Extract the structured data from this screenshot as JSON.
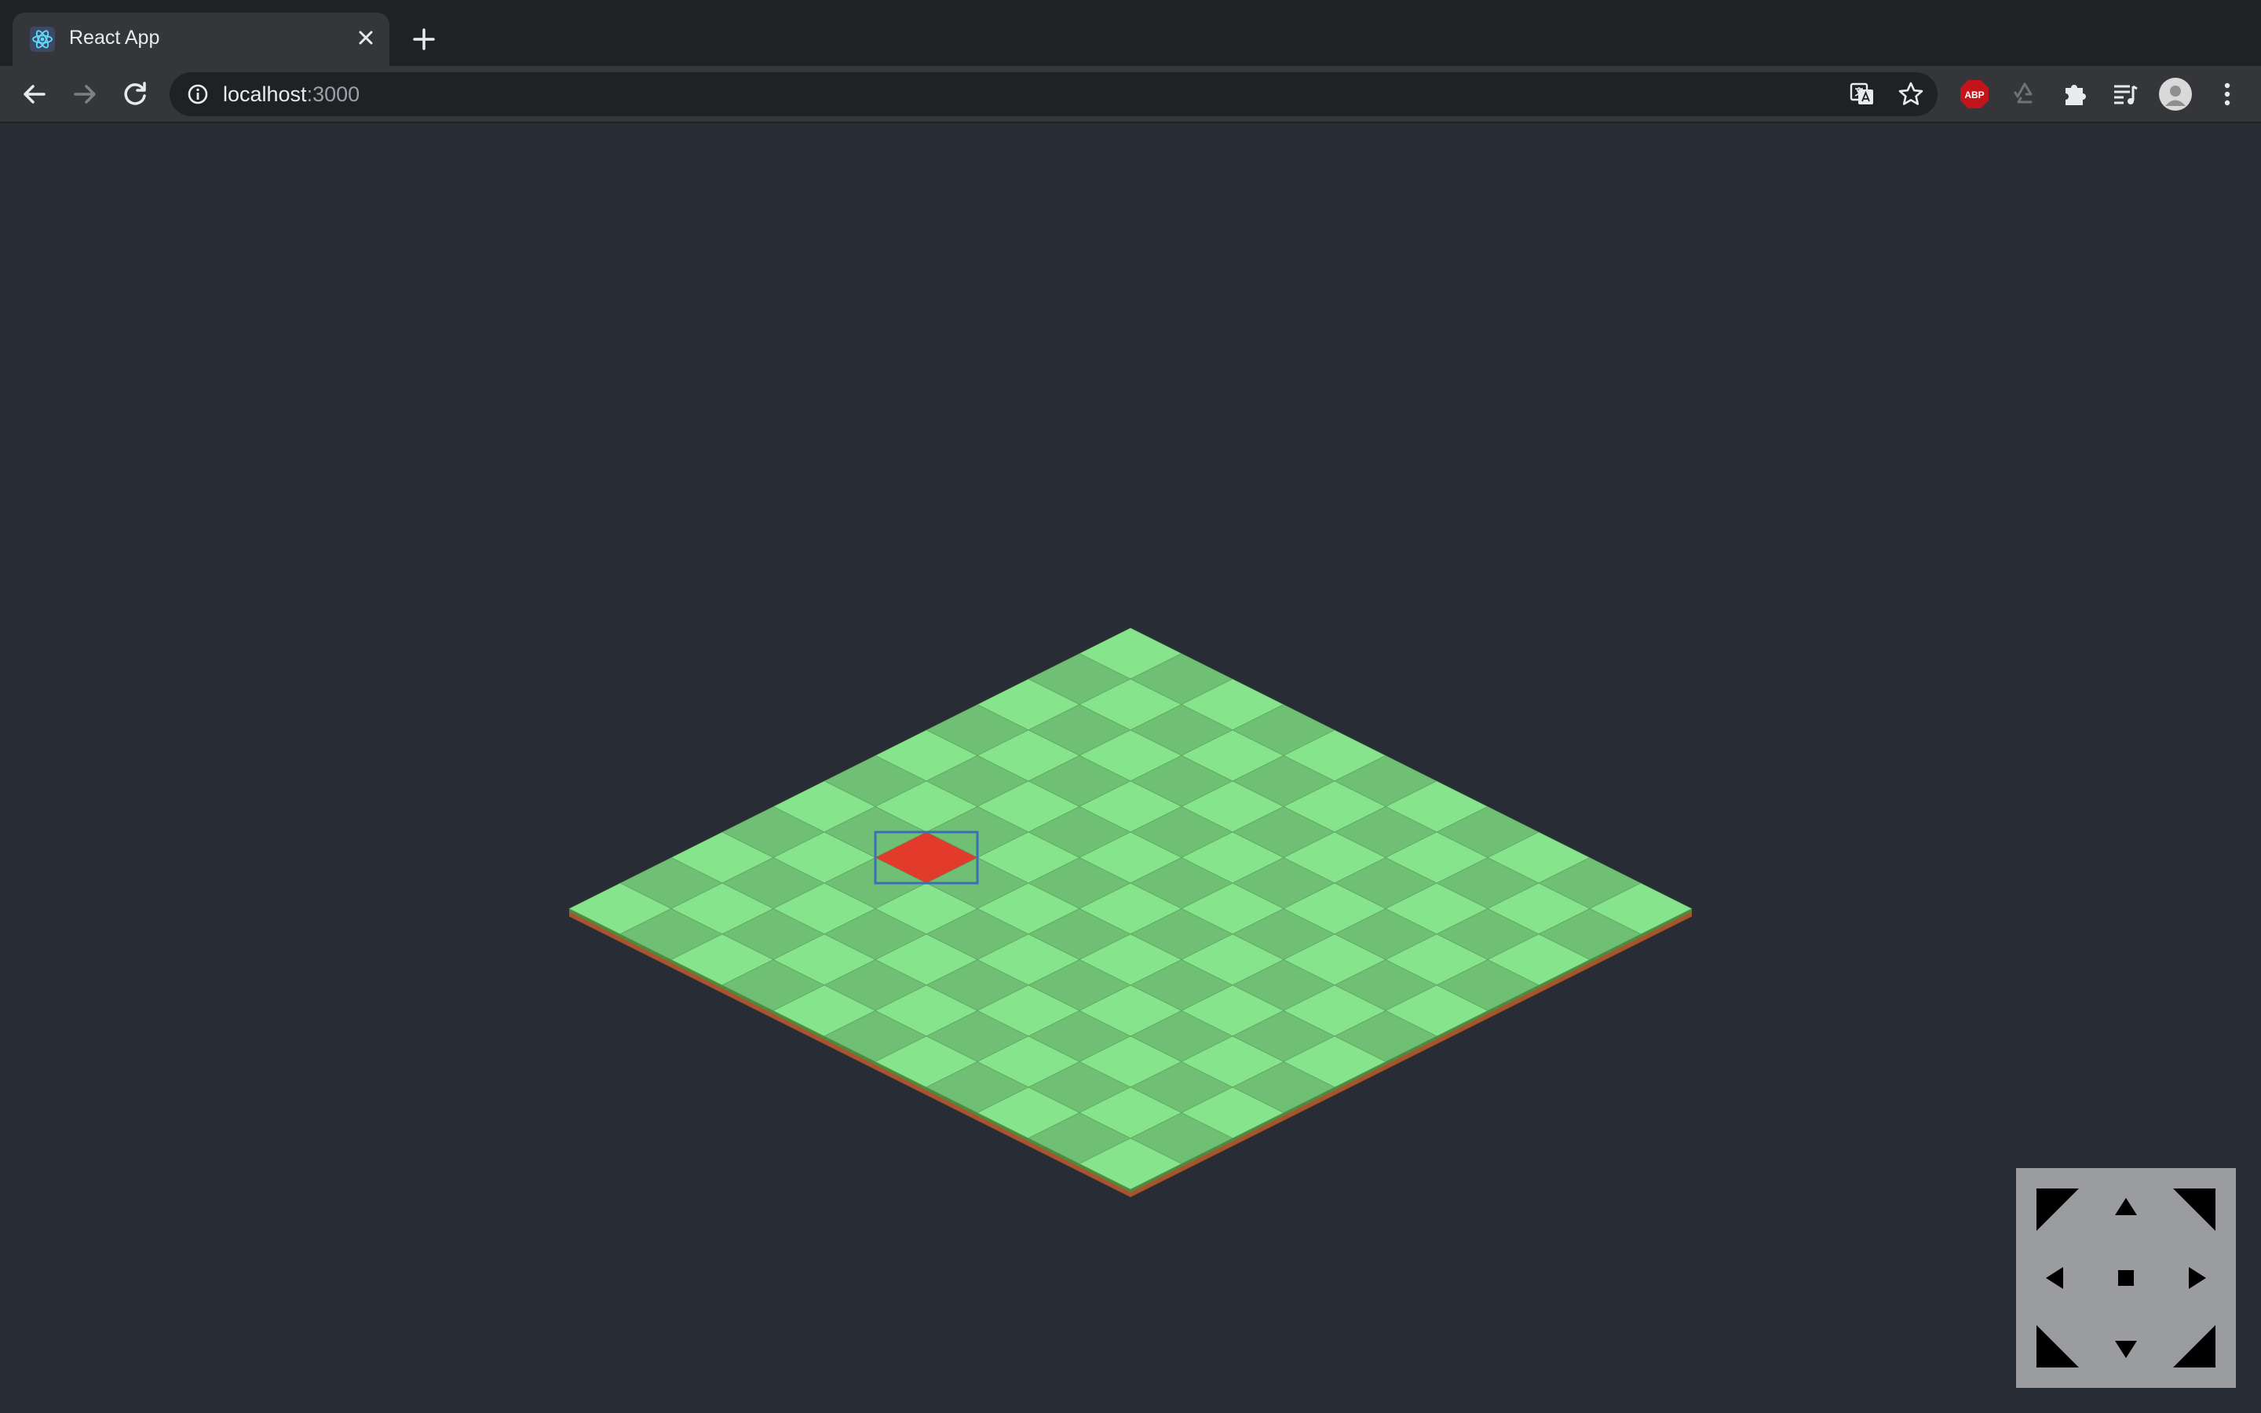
{
  "browser": {
    "tab": {
      "title": "React App",
      "favicon": "react-logo-icon",
      "close_icon": "close-icon"
    },
    "new_tab_icon": "plus-icon",
    "nav": {
      "back_icon": "arrow-left-icon",
      "forward_icon": "arrow-right-icon",
      "reload_icon": "reload-icon"
    },
    "address_bar": {
      "info_icon": "info-icon",
      "host": "localhost",
      "port": ":3000",
      "translate_icon": "translate-icon",
      "bookmark_icon": "star-icon"
    },
    "extensions": [
      {
        "name": "adblock-icon",
        "label": "ABP"
      },
      {
        "name": "recycle-icon"
      },
      {
        "name": "puzzle-icon"
      },
      {
        "name": "media-playlist-icon"
      },
      {
        "name": "profile-avatar"
      },
      {
        "name": "kebab-menu-icon"
      }
    ]
  },
  "board": {
    "rows": 11,
    "cols": 11,
    "selected_tile": {
      "row": 6,
      "col": 2
    },
    "colors": {
      "tile_light": "#86e58c",
      "tile_dark": "#6fbf74",
      "tile_selected": "#e23b2c",
      "selection_outline": "#3a6fb8",
      "edge": "#4f8a3e",
      "edge_dirt": "#a8532b"
    }
  },
  "controls": {
    "buttons": [
      {
        "name": "move-up-left-button",
        "icon": "corner-up-left-icon"
      },
      {
        "name": "move-up-button",
        "icon": "triangle-up-icon"
      },
      {
        "name": "move-up-right-button",
        "icon": "corner-up-right-icon"
      },
      {
        "name": "move-left-button",
        "icon": "triangle-left-icon"
      },
      {
        "name": "stop-button",
        "icon": "square-icon"
      },
      {
        "name": "move-right-button",
        "icon": "triangle-right-icon"
      },
      {
        "name": "move-down-left-button",
        "icon": "corner-down-left-icon"
      },
      {
        "name": "move-down-button",
        "icon": "triangle-down-icon"
      },
      {
        "name": "move-down-right-button",
        "icon": "corner-down-right-icon"
      }
    ],
    "background": "#9a9c9f",
    "icon_color": "#000000"
  }
}
